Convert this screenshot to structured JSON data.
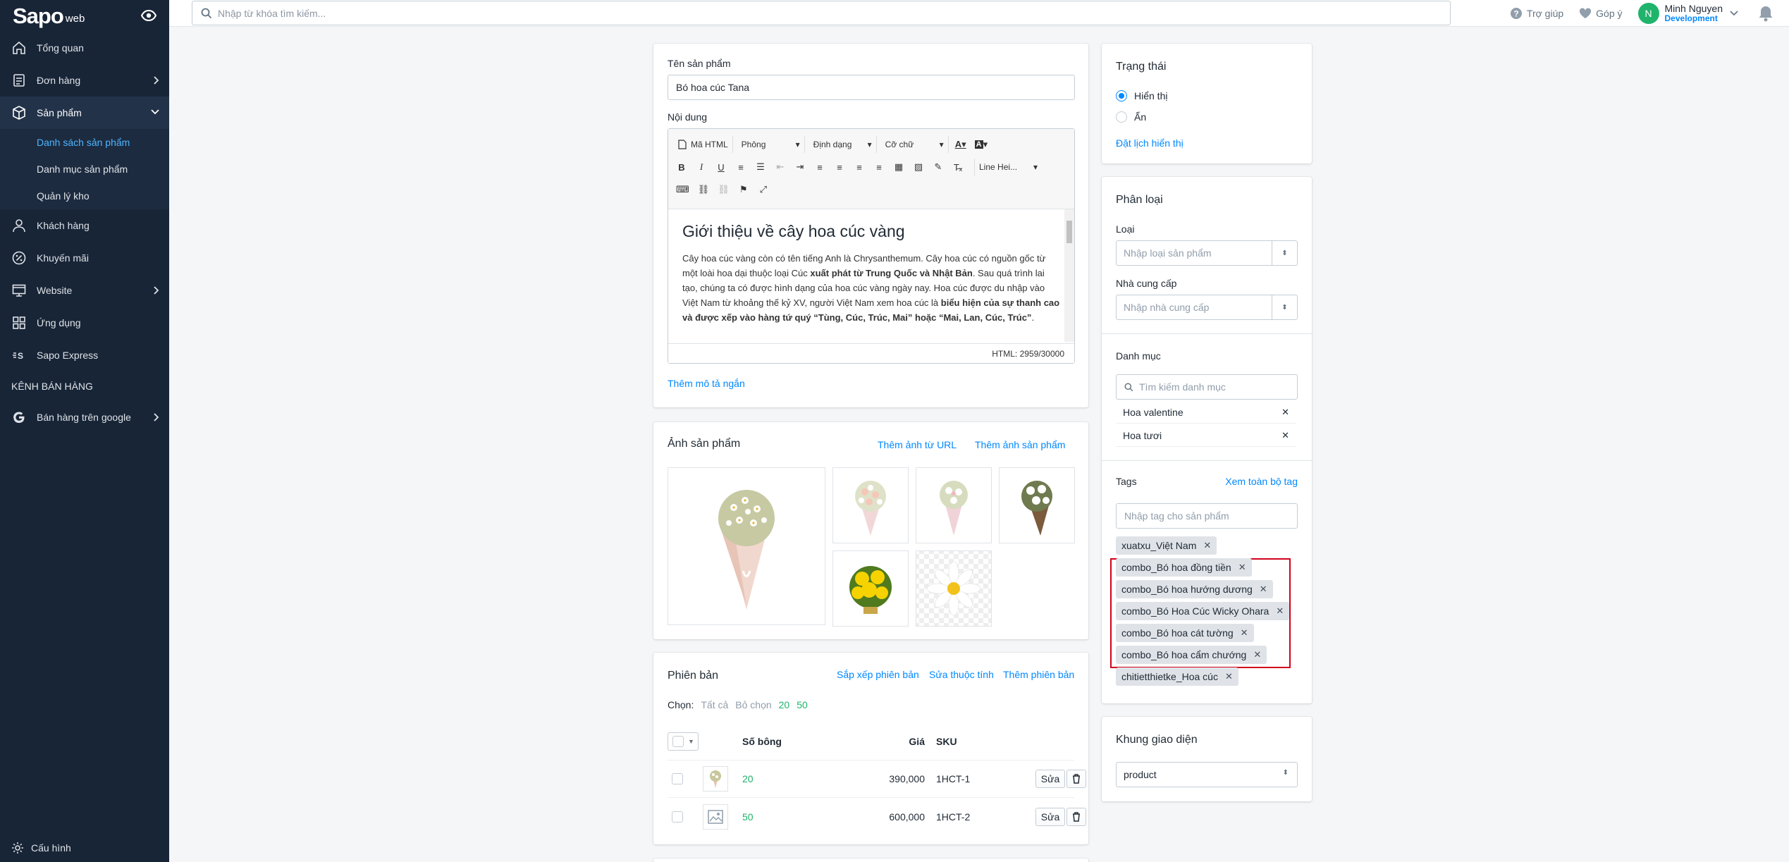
{
  "sidebar": {
    "logo_main": "Sapo",
    "logo_sub": "web",
    "items": [
      {
        "label": "Tổng quan"
      },
      {
        "label": "Đơn hàng"
      },
      {
        "label": "Sản phẩm"
      },
      {
        "label": "Khách hàng"
      },
      {
        "label": "Khuyến mãi"
      },
      {
        "label": "Website"
      },
      {
        "label": "Ứng dụng"
      },
      {
        "label": "Sapo Express"
      }
    ],
    "sub_items": [
      {
        "label": "Danh sách sản phẩm"
      },
      {
        "label": "Danh mục sản phẩm"
      },
      {
        "label": "Quản lý kho"
      }
    ],
    "section_label": "KÊNH BÁN HÀNG",
    "channel_item": "Bán hàng trên google",
    "settings": "Cấu hình"
  },
  "topbar": {
    "search_placeholder": "Nhập từ khóa tìm kiếm...",
    "help": "Trợ giúp",
    "feedback": "Góp ý",
    "avatar_letter": "N",
    "user_name": "Minh Nguyen",
    "user_env": "Development"
  },
  "product": {
    "name_label": "Tên sản phẩm",
    "name_value": "Bó hoa cúc Tana",
    "content_label": "Nội dung",
    "toolbar": {
      "html_btn": "Mã HTML",
      "font_sel": "Phông",
      "format_sel": "Định dạng",
      "size_sel": "Cỡ chữ",
      "line_height_sel": "Line Hei..."
    },
    "content_heading": "Giới thiệu về cây hoa cúc vàng",
    "content_p1": "Cây hoa cúc vàng còn có tên tiếng Anh là Chrysanthemum. Cây hoa cúc có nguồn gốc từ một loài hoa dại thuộc loại Cúc ",
    "content_b1": "xuất phát từ Trung Quốc và Nhật Bản",
    "content_p2": ". Sau quá trình lai tạo, chúng ta có được hình dạng của hoa cúc vàng ngày nay. Hoa cúc được du nhập vào Việt Nam từ khoảng thế kỷ XV, người Việt Nam xem hoa cúc là ",
    "content_b2": "biểu hiện của sự thanh cao và được xếp vào hàng tứ quý “Tùng, Cúc, Trúc, Mai” hoặc “Mai, Lan, Cúc, Trúc”",
    "content_p3": ".",
    "html_count": "HTML: 2959/30000",
    "short_desc_link": "Thêm mô tả ngắn"
  },
  "images": {
    "title": "Ảnh sản phẩm",
    "add_url": "Thêm ảnh từ URL",
    "add_image": "Thêm ảnh sản phẩm"
  },
  "variants": {
    "title": "Phiên bản",
    "sort": "Sắp xếp phiên bản",
    "edit_attr": "Sửa thuộc tính",
    "add": "Thêm phiên bản",
    "choose_label": "Chọn:",
    "all": "Tất cả",
    "none": "Bỏ chọn",
    "opt1": "20",
    "opt2": "50",
    "headers": [
      "Số bông",
      "Giá",
      "SKU"
    ],
    "rows": [
      {
        "name": "20",
        "price": "390,000",
        "sku": "1HCT-1",
        "edit": "Sửa"
      },
      {
        "name": "50",
        "price": "600,000",
        "sku": "1HCT-2",
        "edit": "Sửa"
      }
    ]
  },
  "status": {
    "title": "Trạng thái",
    "show": "Hiển thị",
    "hide": "Ẩn",
    "schedule": "Đặt lịch hiển thị"
  },
  "classification": {
    "title": "Phân loại",
    "type_label": "Loại",
    "type_placeholder": "Nhập loại sản phẩm",
    "vendor_label": "Nhà cung cấp",
    "vendor_placeholder": "Nhập nhà cung cấp",
    "category_label": "Danh mục",
    "category_placeholder": "Tìm kiếm danh mục",
    "categories": [
      "Hoa valentine",
      "Hoa tươi"
    ],
    "tags_label": "Tags",
    "view_all_tags": "Xem toàn bộ tag",
    "tags_placeholder": "Nhập tag cho sản phẩm",
    "tags": [
      "xuatxu_Việt Nam",
      "combo_Bó hoa đồng tiền",
      "combo_Bó hoa hướng dương",
      "combo_Bó Hoa Cúc Wicky Ohara",
      "combo_Bó hoa cát tường",
      "combo_Bó hoa cẩm chướng",
      "chitietthietke_Hoa cúc"
    ]
  },
  "theme": {
    "title": "Khung giao diện",
    "value": "product"
  },
  "colors": {
    "sidebar_bg": "#182537",
    "accent": "#0088ff",
    "highlight_box": "#d0021b",
    "variant_link": "#1fb36b"
  }
}
